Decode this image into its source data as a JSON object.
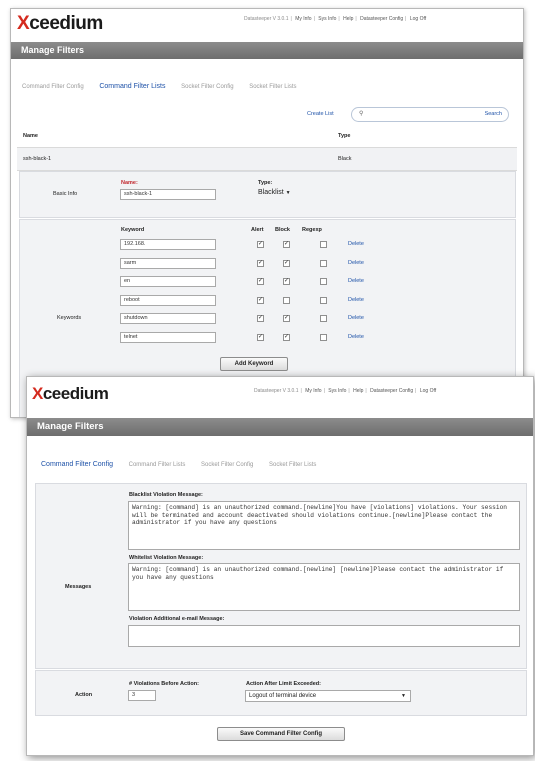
{
  "back": {
    "logo_x": "X",
    "logo_rest": "ceedium",
    "top_links": [
      "Datasteeper V 3.0.1",
      "My Info",
      "Sys Info",
      "Help",
      "Datasteeper Config",
      "Log Off"
    ],
    "header": "Manage Filters",
    "tabs": [
      "Command Filter Config",
      "Command Filter Lists",
      "Socket Filter Config",
      "Socket Filter Lists"
    ],
    "active_tab": 1,
    "create_list": "Create List",
    "search_label": "Search",
    "col_name": "Name",
    "col_type": "Type",
    "list_name": "ssh-black-1",
    "list_type": "Black",
    "basic_info_label": "Basic Info",
    "name_label": "Name:",
    "name_value": "ssh-black-1",
    "type_label": "Type:",
    "type_value": "Blacklist",
    "kw_col_keyword": "Keyword",
    "kw_col_alert": "Alert",
    "kw_col_block": "Block",
    "kw_col_regexp": "Regexp",
    "keywords_label": "Keywords",
    "keywords": [
      {
        "keyword": "192.168.",
        "alert": true,
        "block": true,
        "regexp": false,
        "action": "Delete"
      },
      {
        "keyword": "sarm",
        "alert": true,
        "block": true,
        "regexp": false,
        "action": "Delete"
      },
      {
        "keyword": "en",
        "alert": true,
        "block": true,
        "regexp": false,
        "action": "Delete"
      },
      {
        "keyword": "reboot",
        "alert": true,
        "block": false,
        "regexp": false,
        "action": "Delete"
      },
      {
        "keyword": "shutdown",
        "alert": true,
        "block": true,
        "regexp": false,
        "action": "Delete"
      },
      {
        "keyword": "telnet",
        "alert": true,
        "block": true,
        "regexp": false,
        "action": "Delete"
      }
    ],
    "add_keyword": "Add Keyword"
  },
  "front": {
    "logo_x": "X",
    "logo_rest": "ceedium",
    "top_links": [
      "Datasteeper V 3.0.1",
      "My Info",
      "Sys Info",
      "Help",
      "Datasteeper Config",
      "Log Off"
    ],
    "header": "Manage Filters",
    "tabs": [
      "Command Filter Config",
      "Command Filter Lists",
      "Socket Filter Config",
      "Socket Filter Lists"
    ],
    "active_tab": 0,
    "messages_label": "Messages",
    "blacklist_label": "Blacklist Violation Message:",
    "blacklist_text": "Warning: [command] is an unauthorized command.[newline]You have [violations] violations. Your session will be terminated and account deactivated should violations continue.[newline]Please contact the administrator if you have any questions",
    "whitelist_label": "Whitelist Violation Message:",
    "whitelist_text": "Warning: [command] is an unauthorized command.[newline] [newline]Please contact the administrator if you have any questions",
    "email_label": "Violation Additional e-mail Message:",
    "email_text": "",
    "action_label": "Action",
    "violations_label": "# Violations Before Action:",
    "violations_value": "3",
    "after_label": "Action After Limit Exceeded:",
    "after_value": "Logout of terminal device",
    "save_button": "Save Command Filter Config"
  }
}
